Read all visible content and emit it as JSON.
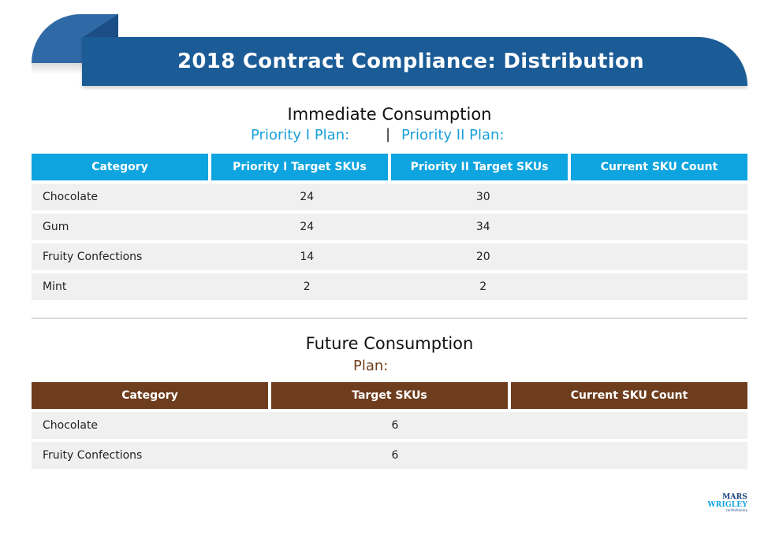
{
  "header": {
    "title": "2018 Contract Compliance: Distribution"
  },
  "immediate": {
    "section_title": "Immediate Consumption",
    "plan1_label": "Priority I Plan:",
    "separator": "|",
    "plan2_label": "Priority II Plan:",
    "columns": [
      "Category",
      "Priority I Target SKUs",
      "Priority II Target SKUs",
      "Current SKU Count"
    ],
    "rows": [
      {
        "category": "Chocolate",
        "p1": "24",
        "p2": "30",
        "current": ""
      },
      {
        "category": "Gum",
        "p1": "24",
        "p2": "34",
        "current": ""
      },
      {
        "category": "Fruity Confections",
        "p1": "14",
        "p2": "20",
        "current": ""
      },
      {
        "category": "Mint",
        "p1": "2",
        "p2": "2",
        "current": ""
      }
    ]
  },
  "future": {
    "section_title": "Future Consumption",
    "plan_label": "Plan:",
    "columns": [
      "Category",
      "Target SKUs",
      "Current SKU Count"
    ],
    "rows": [
      {
        "category": "Chocolate",
        "target": "6",
        "current": ""
      },
      {
        "category": "Fruity Confections",
        "target": "6",
        "current": ""
      }
    ]
  },
  "logo": {
    "brand_part1": "MARS",
    "brand_part2": "WRIGLEY",
    "subtitle": "confectionery"
  },
  "colors": {
    "banner": "#1b5b96",
    "immediate_header": "#0da4e0",
    "future_header": "#6e3d1e",
    "row_bg": "#f0f0f0"
  }
}
